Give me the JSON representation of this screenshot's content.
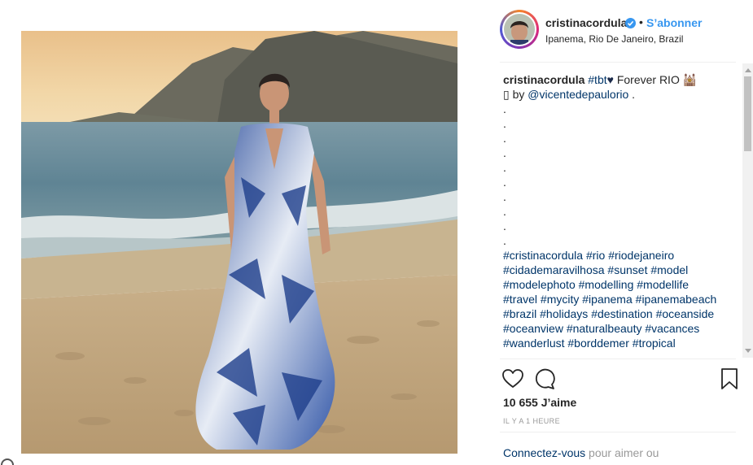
{
  "post": {
    "username": "cristinacordula",
    "separator": "•",
    "follow_label": "S’abonner",
    "location": "Ipanema, Rio De Janeiro, Brazil"
  },
  "caption": {
    "username": "cristinacordula",
    "tag_tbt": "#tbt",
    "heart": "♥",
    "text_forever": " Forever RIO ",
    "emoji_temple": "🕍",
    "camera_glyph": "▯",
    "by_text": " by ",
    "mention": "@vicentedepaulorio",
    "mention_tail": " .",
    "dots": [
      ".",
      ".",
      ".",
      ".",
      ".",
      ".",
      ".",
      ".",
      ".",
      "."
    ],
    "hashtags": [
      "#cristinacordula",
      "#rio",
      "#riodejaneiro",
      "#cidademaravilhosa",
      "#sunset",
      "#model",
      "#modelephoto",
      "#modelling",
      "#modellife",
      "#travel",
      "#mycity",
      "#ipanema",
      "#ipanemabeach",
      "#brazil",
      "#holidays",
      "#destination",
      "#oceanside",
      "#oceanview",
      "#naturalbeauty",
      "#vacances",
      "#wanderlust",
      "#borddemer",
      "#tropical"
    ]
  },
  "likes": "10 655 J’aime",
  "time_ago": "IL Y A 1 HEURE",
  "login": {
    "link": "Connectez-vous",
    "rest": " pour aimer ou"
  },
  "icons": {
    "like": "heart-outline-icon",
    "comment": "comment-bubble-icon",
    "save": "bookmark-icon",
    "verified": "verified-badge-icon"
  },
  "colors": {
    "follow": "#3897f0",
    "hashtag": "#003569",
    "verified": "#3897f0"
  }
}
